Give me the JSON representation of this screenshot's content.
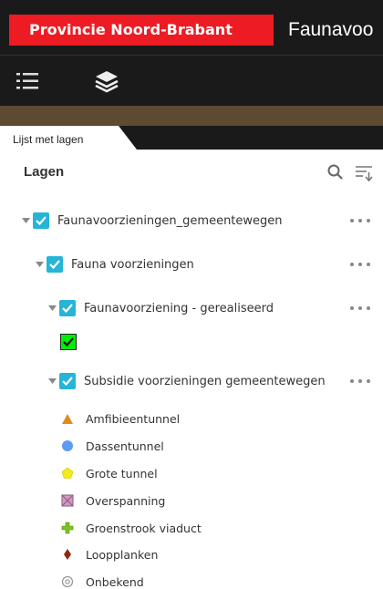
{
  "header": {
    "org_logo_text": "Provincie Noord-Brabant",
    "app_title": "Faunavoo"
  },
  "toolbar": {
    "list_icon": "list-icon",
    "layers_icon": "layers-icon"
  },
  "tab": {
    "label": "Lijst met lagen"
  },
  "panel": {
    "title": "Lagen",
    "search_icon": "search-icon",
    "sort_icon": "sort-filter-icon"
  },
  "layers": [
    {
      "label": "Faunavoorzieningen_gemeentewegen",
      "checked": true,
      "expanded": true
    },
    {
      "label": "Fauna voorzieningen",
      "checked": true,
      "expanded": true
    },
    {
      "label": "Faunavoorziening - gerealiseerd",
      "checked": true,
      "expanded": true
    },
    {
      "label": "Subsidie voorzieningen gemeentewegen",
      "checked": true,
      "expanded": true
    }
  ],
  "legend": [
    {
      "label": "Amfibieentunnel",
      "symbol": "orange-triangle",
      "color": "#e08a1e"
    },
    {
      "label": "Dassentunnel",
      "symbol": "blue-circle",
      "color": "#5b9bf0"
    },
    {
      "label": "Grote tunnel",
      "symbol": "yellow-pentagon",
      "color": "#f2ea1a"
    },
    {
      "label": "Overspanning",
      "symbol": "pink-crossed-square",
      "color": "#d39ac2"
    },
    {
      "label": "Groenstrook viaduct",
      "symbol": "green-cross",
      "color": "#7cc41e"
    },
    {
      "label": "Loopplanken",
      "symbol": "brown-diamond",
      "color": "#8b2a10"
    },
    {
      "label": "Onbekend",
      "symbol": "grey-ring",
      "color": "#9a9a9a"
    }
  ],
  "colors": {
    "header_bg": "#1a1a1a",
    "logo_bg": "#ed1c24",
    "accent_checkbox": "#26b4d8",
    "brown_bar": "#5e4a33"
  }
}
